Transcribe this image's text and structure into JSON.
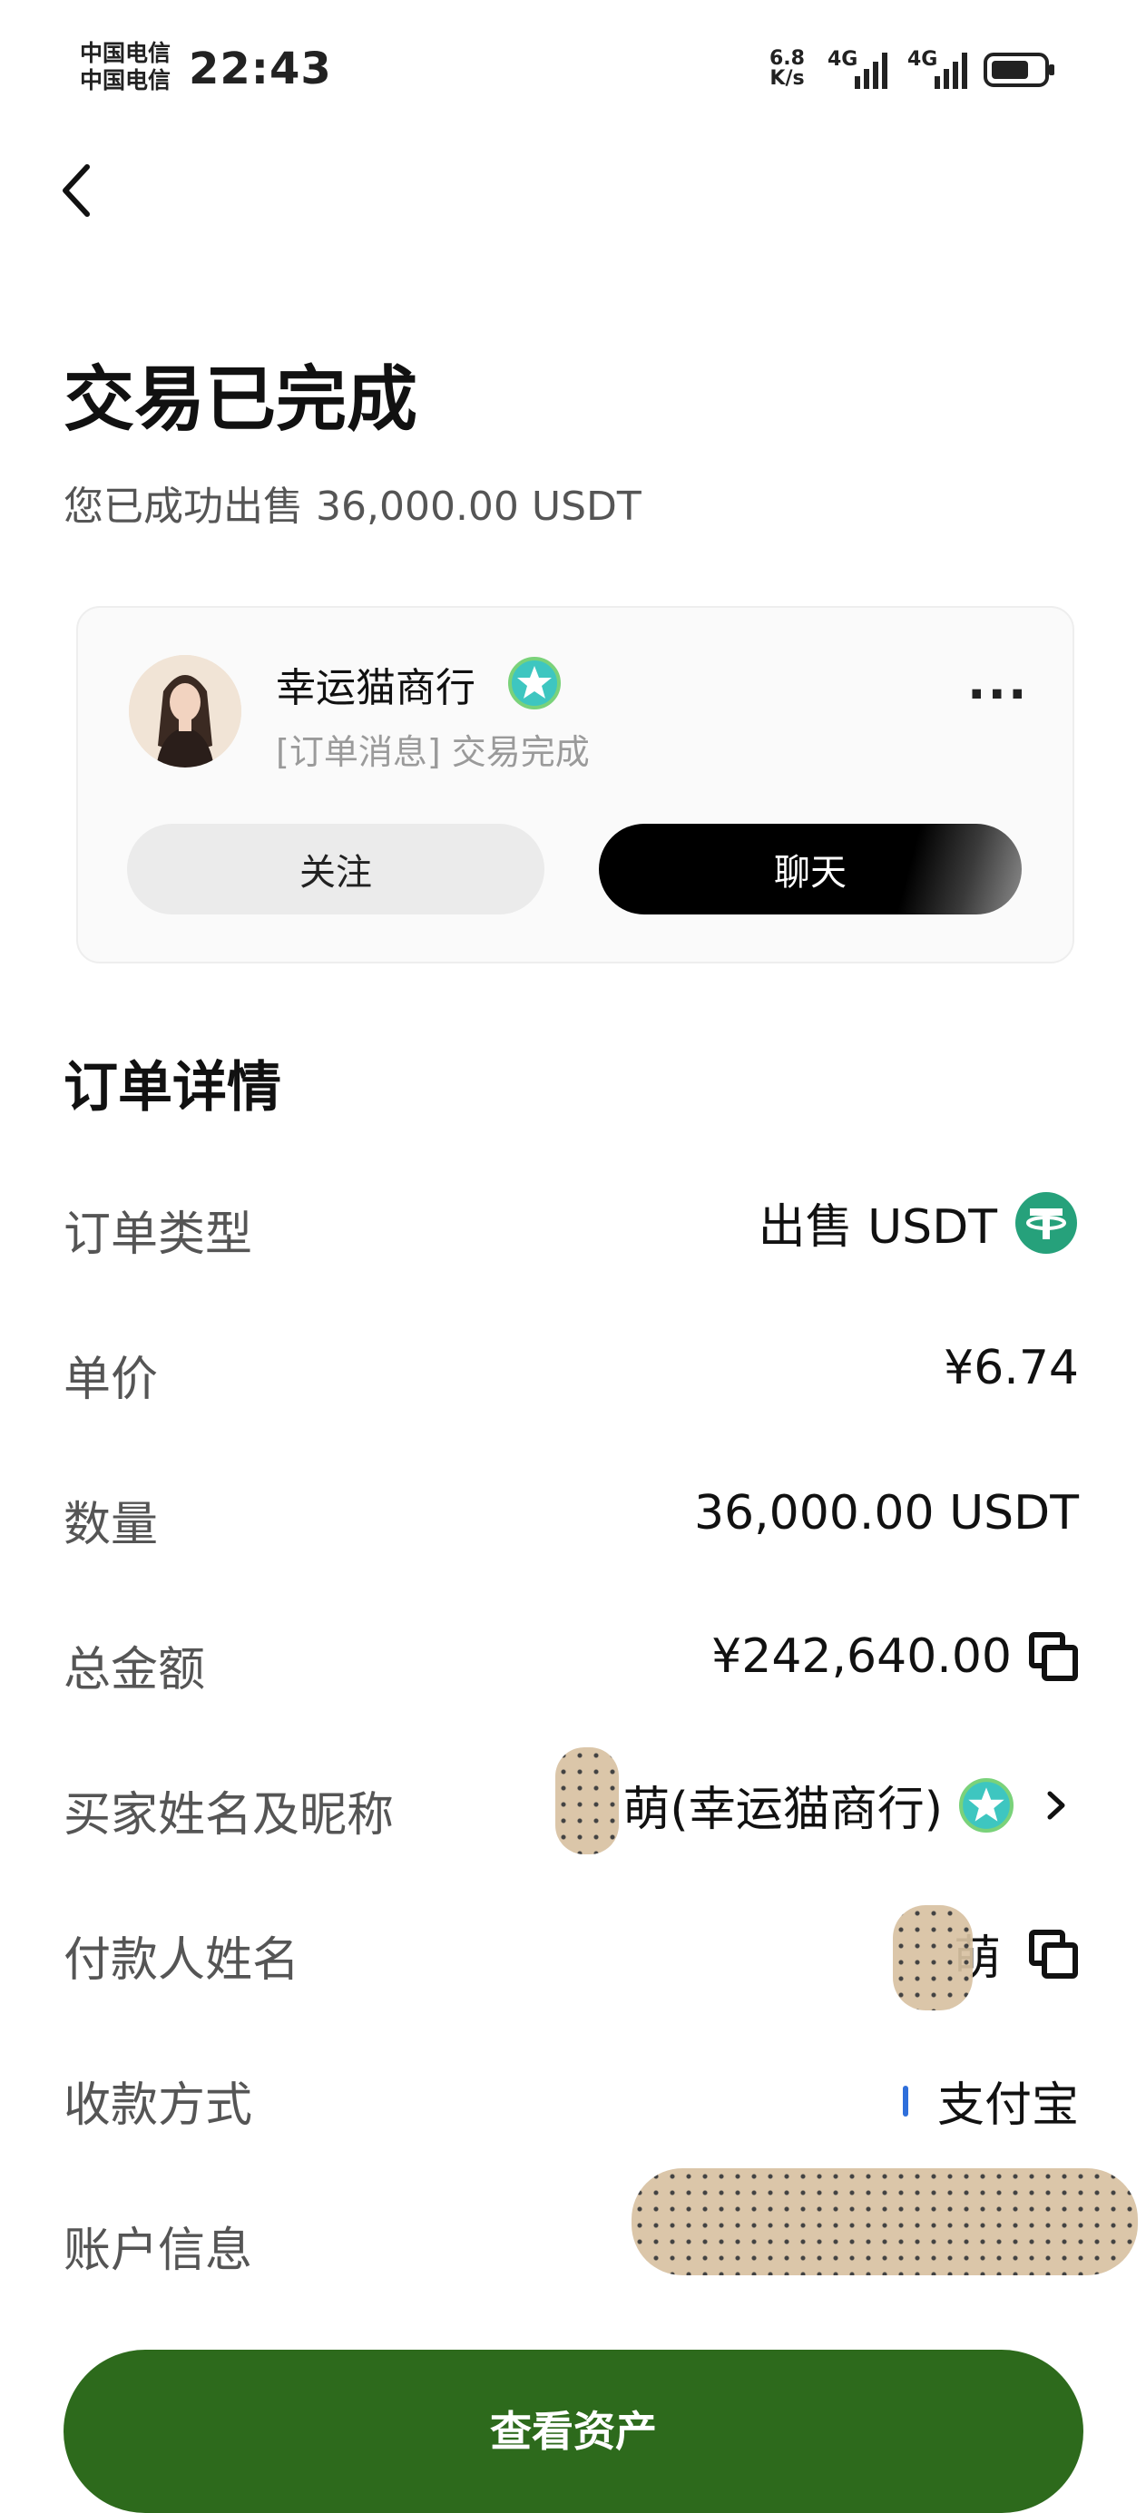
{
  "status_bar": {
    "carrier_1": "中国电信",
    "carrier_2": "中国电信",
    "time": "22:43",
    "speed_value": "6.8",
    "speed_unit": "K/s",
    "net_1": "4G",
    "net_2": "4G"
  },
  "header": {
    "title": "交易已完成",
    "subtitle": "您已成功出售 36,000.00 USDT"
  },
  "merchant": {
    "name": "幸运猫商行",
    "message": "[订单消息] 交易完成",
    "follow_label": "关注",
    "chat_label": "聊天"
  },
  "order": {
    "section_title": "订单详情",
    "rows": [
      {
        "label": "订单类型",
        "value": "出售 USDT"
      },
      {
        "label": "单价",
        "value": "¥6.74"
      },
      {
        "label": "数量",
        "value": "36,000.00 USDT"
      },
      {
        "label": "总金额",
        "value": "¥242,640.00"
      },
      {
        "label": "买家姓名及昵称",
        "value": "萌(幸运猫商行)"
      },
      {
        "label": "付款人姓名",
        "value": "萌"
      },
      {
        "label": "收款方式",
        "value": "支付宝"
      },
      {
        "label": "账户信息",
        "value": ""
      }
    ]
  },
  "footer": {
    "assets_button": "查看资产"
  },
  "colors": {
    "primary_button": "#2d6a1c",
    "tether": "#26a17b",
    "verified": "#3ec6c0"
  }
}
